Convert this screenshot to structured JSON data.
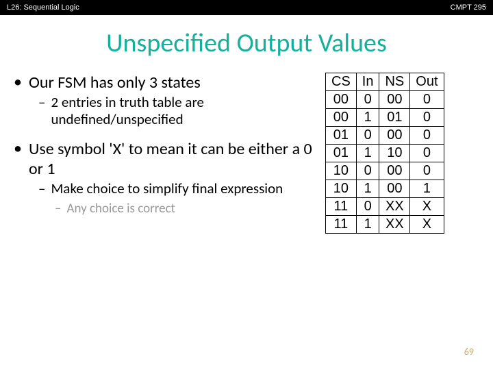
{
  "header": {
    "left": "L26: Sequential Logic",
    "right": "CMPT 295"
  },
  "title": "Unspecified Output Values",
  "bullets": {
    "b1": "Our FSM has only 3 states",
    "b1a": "2 entries in truth table are undefined/unspecified",
    "b2": "Use symbol 'X' to mean it can be either a 0 or 1",
    "b2a": "Make choice to simplify final expression",
    "b2b": "Any choice is correct"
  },
  "table": {
    "headers": [
      "CS",
      "In",
      "NS",
      "Out"
    ],
    "rows": [
      [
        "00",
        "0",
        "00",
        "0"
      ],
      [
        "00",
        "1",
        "01",
        "0"
      ],
      [
        "01",
        "0",
        "00",
        "0"
      ],
      [
        "01",
        "1",
        "10",
        "0"
      ],
      [
        "10",
        "0",
        "00",
        "0"
      ],
      [
        "10",
        "1",
        "00",
        "1"
      ],
      [
        "11",
        "0",
        "XX",
        "X"
      ],
      [
        "11",
        "1",
        "XX",
        "X"
      ]
    ]
  },
  "pagenum": "69",
  "chart_data": {
    "type": "table",
    "title": "Unspecified Output Values truth table",
    "columns": [
      "CS",
      "In",
      "NS",
      "Out"
    ],
    "rows": [
      [
        "00",
        "0",
        "00",
        "0"
      ],
      [
        "00",
        "1",
        "01",
        "0"
      ],
      [
        "01",
        "0",
        "00",
        "0"
      ],
      [
        "01",
        "1",
        "10",
        "0"
      ],
      [
        "10",
        "0",
        "00",
        "0"
      ],
      [
        "10",
        "1",
        "00",
        "1"
      ],
      [
        "11",
        "0",
        "XX",
        "X"
      ],
      [
        "11",
        "1",
        "XX",
        "X"
      ]
    ]
  }
}
